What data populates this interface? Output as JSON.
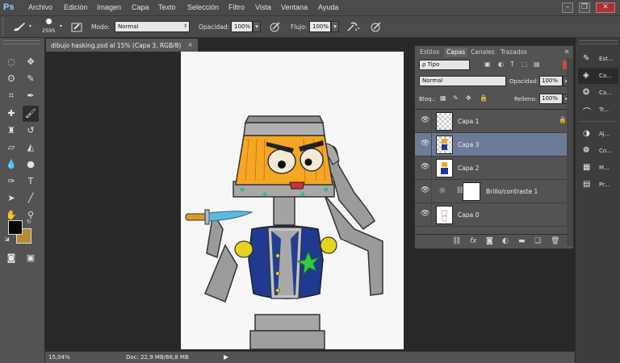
{
  "app": {
    "logo": "Ps"
  },
  "menu": [
    "Archivo",
    "Edición",
    "Imagen",
    "Capa",
    "Texto",
    "Selección",
    "Filtro",
    "Vista",
    "Ventana",
    "Ayuda"
  ],
  "options": {
    "brush_size": "2595",
    "mode_label": "Modo:",
    "mode_value": "Normal",
    "opacity_label": "Opacidad:",
    "opacity_value": "100%",
    "flow_label": "Flujo:",
    "flow_value": "100%"
  },
  "document": {
    "tab_title": "dibujo hasking.psd al 15% (Capa 3, RGB/8)",
    "close": "×"
  },
  "status": {
    "zoom": "15,04%",
    "doc_size": "Doc: 22,9 MB/66,8 MB"
  },
  "colors": {
    "foreground": "#050505",
    "background": "#b68c33",
    "selection": "#6c7b98"
  },
  "layers_panel": {
    "tabs": [
      {
        "label": "Estilos",
        "active": false
      },
      {
        "label": "Capas",
        "active": true
      },
      {
        "label": "Canales",
        "active": false
      },
      {
        "label": "Trazados",
        "active": false
      }
    ],
    "filter_kind": "ρ Tipo",
    "blend_mode": "Normal",
    "opacity_label": "Opacidad:",
    "opacity_value": "100%",
    "lock_label": "Bloq.:",
    "fill_label": "Relleno:",
    "fill_value": "100%",
    "layers": [
      {
        "name": "Capa 1",
        "selected": false,
        "locked": true
      },
      {
        "name": "Capa 3",
        "selected": true,
        "locked": false
      },
      {
        "name": "Capa 2",
        "selected": false,
        "locked": false
      },
      {
        "name": "Brillo/contraste 1",
        "selected": false,
        "locked": false
      },
      {
        "name": "Capa 0",
        "selected": false,
        "locked": false
      }
    ]
  },
  "dock": [
    {
      "label": "Est...",
      "icon": "brush-presets-icon"
    },
    {
      "label": "Ca...",
      "icon": "layers-icon"
    },
    {
      "label": "Ca...",
      "icon": "channels-icon"
    },
    {
      "label": "Tr...",
      "icon": "paths-icon"
    },
    {
      "label": "Aj...",
      "icon": "adjustments-icon"
    },
    {
      "label": "Co...",
      "icon": "color-icon"
    },
    {
      "label": "M...",
      "icon": "swatches-icon"
    },
    {
      "label": "Pr...",
      "icon": "properties-icon"
    }
  ]
}
